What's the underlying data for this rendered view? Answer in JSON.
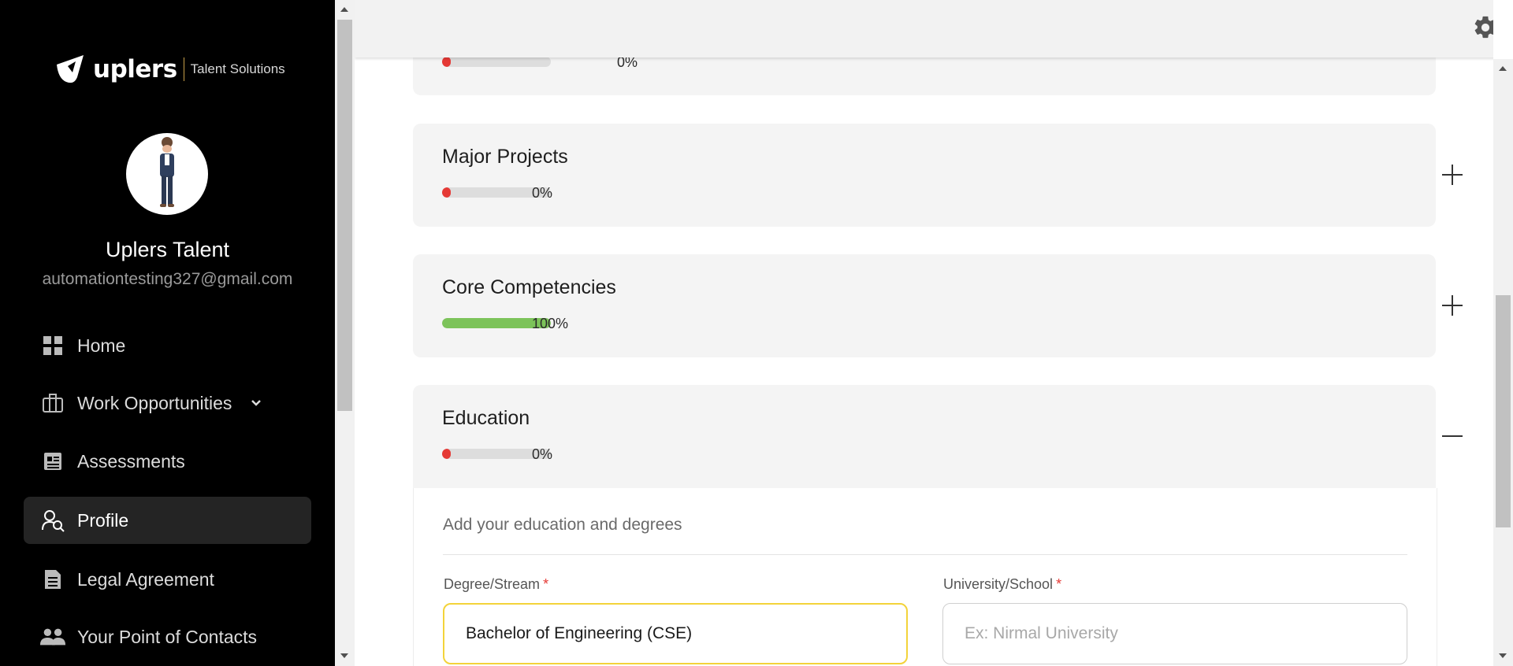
{
  "brand": {
    "name": "uplers",
    "sub": "Talent Solutions"
  },
  "user": {
    "name": "Uplers Talent",
    "email": "automationtesting327@gmail.com"
  },
  "nav": [
    {
      "label": "Home",
      "icon": "grid-icon",
      "active": false
    },
    {
      "label": "Work Opportunities",
      "icon": "briefcase-icon",
      "active": false,
      "has_chevron": true
    },
    {
      "label": "Assessments",
      "icon": "assessment-icon",
      "active": false
    },
    {
      "label": "Profile",
      "icon": "profile-search-icon",
      "active": true
    },
    {
      "label": "Legal Agreement",
      "icon": "document-icon",
      "active": false
    },
    {
      "label": "Your Point of Contacts",
      "icon": "contacts-icon",
      "active": false
    }
  ],
  "sections": {
    "previous": {
      "progress_label": "0%",
      "progress": 0.03
    },
    "major_projects": {
      "title": "Major Projects",
      "progress_label": "0%",
      "progress": 0.03,
      "toggle": "plus"
    },
    "core_competencies": {
      "title": "Core Competencies",
      "progress_label": "100%",
      "progress": 1.0,
      "toggle": "plus"
    },
    "education": {
      "title": "Education",
      "progress_label": "0%",
      "progress": 0.03,
      "toggle": "minus"
    }
  },
  "education_form": {
    "description": "Add your education and degrees",
    "degree": {
      "label": "Degree/Stream",
      "required": "*",
      "value": "Bachelor of Engineering (CSE)"
    },
    "university": {
      "label": "University/School",
      "required": "*",
      "placeholder": "Ex: Nirmal University",
      "value": ""
    }
  },
  "colors": {
    "progress_zero": "#e53935",
    "progress_full": "#7cc35a",
    "focus_border": "#f3d33a"
  }
}
